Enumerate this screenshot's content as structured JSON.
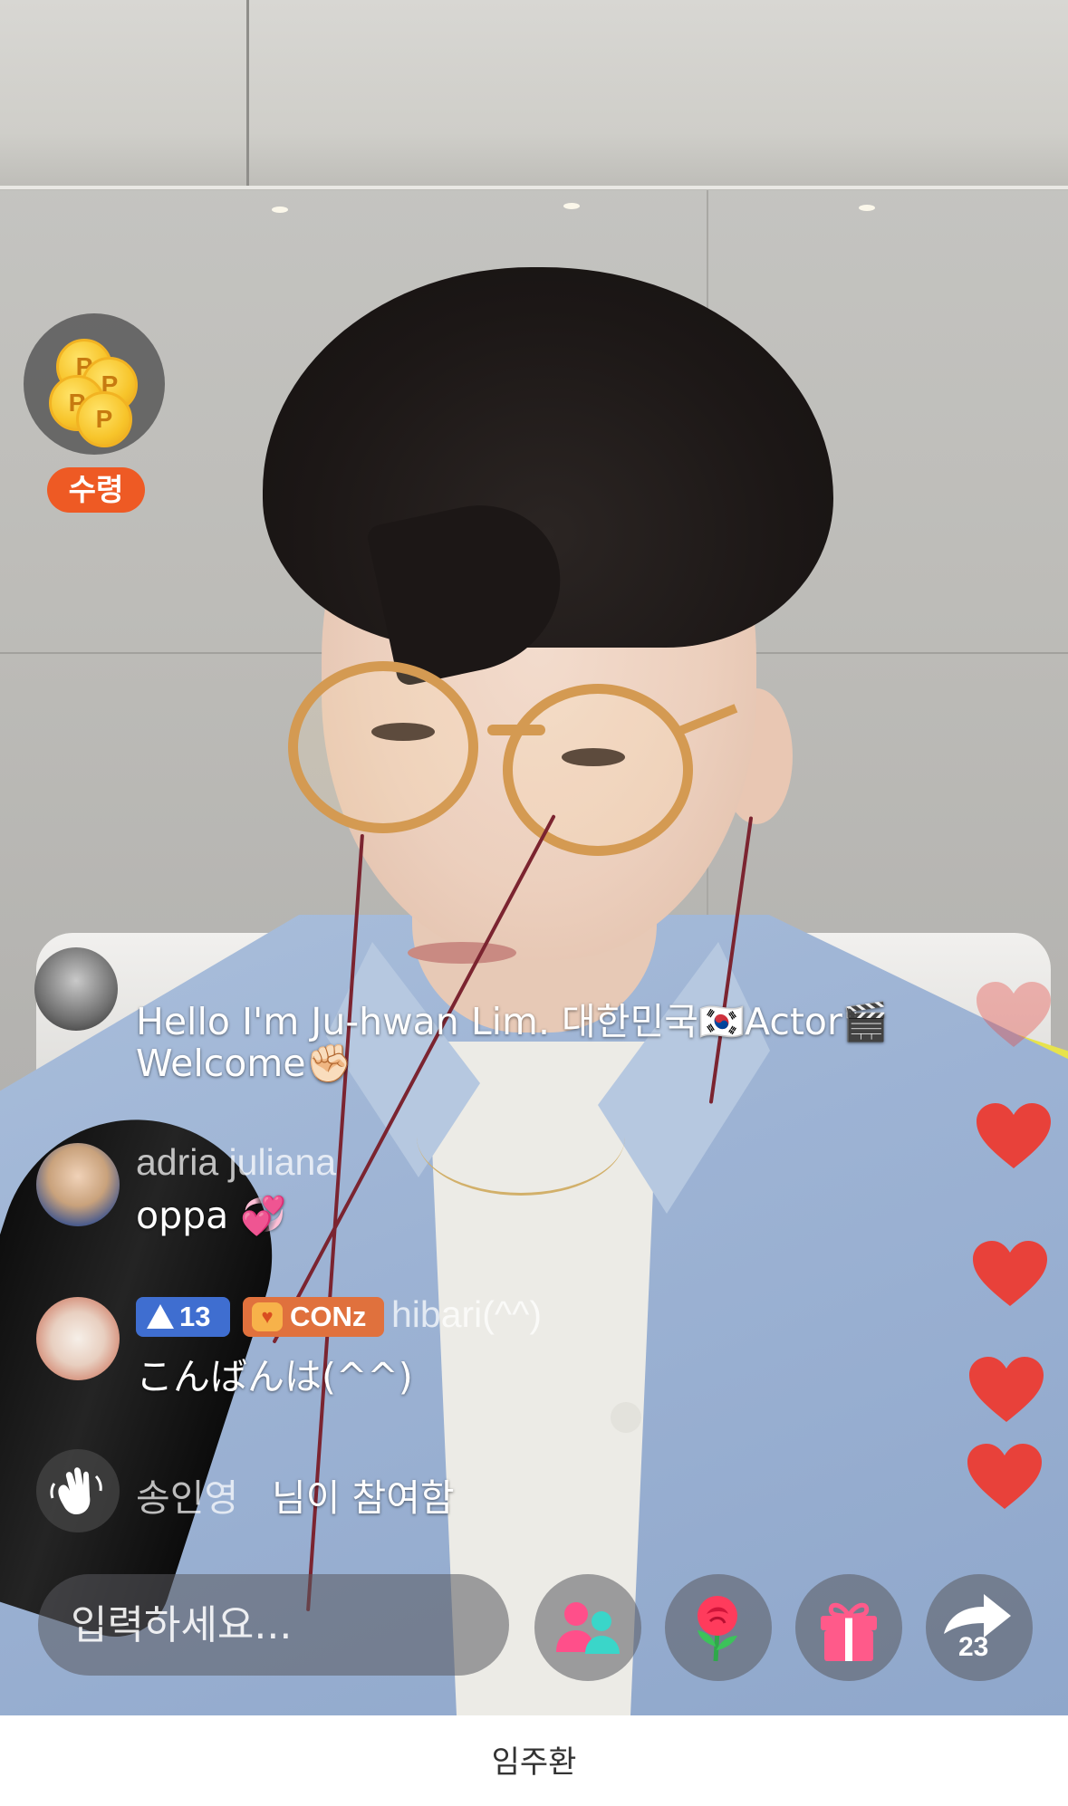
{
  "reward": {
    "coin_symbol": "P",
    "badge_label": "수령"
  },
  "chat": {
    "messages": [
      {
        "text_line1": "Hello I'm Ju-hwan Lim. 대한민국🇰🇷Actor🎬",
        "text_line2": "Welcome✊🏻"
      },
      {
        "name": "adria juliana",
        "text": "oppa 💞"
      },
      {
        "level": "13",
        "badge": "CONz",
        "name": "hibari(^^)",
        "text": "こんばんは(^^)"
      },
      {
        "join_name": "송인영",
        "join_text": "님이 참여함"
      }
    ]
  },
  "composer": {
    "placeholder": "입력하세요..."
  },
  "actions": {
    "share_count": "23",
    "icons": [
      "people-icon",
      "rose-icon",
      "gift-icon",
      "share-icon"
    ]
  },
  "hearts": {
    "color": "#e8413a"
  },
  "footer": {
    "streamer_name": "임주환"
  }
}
